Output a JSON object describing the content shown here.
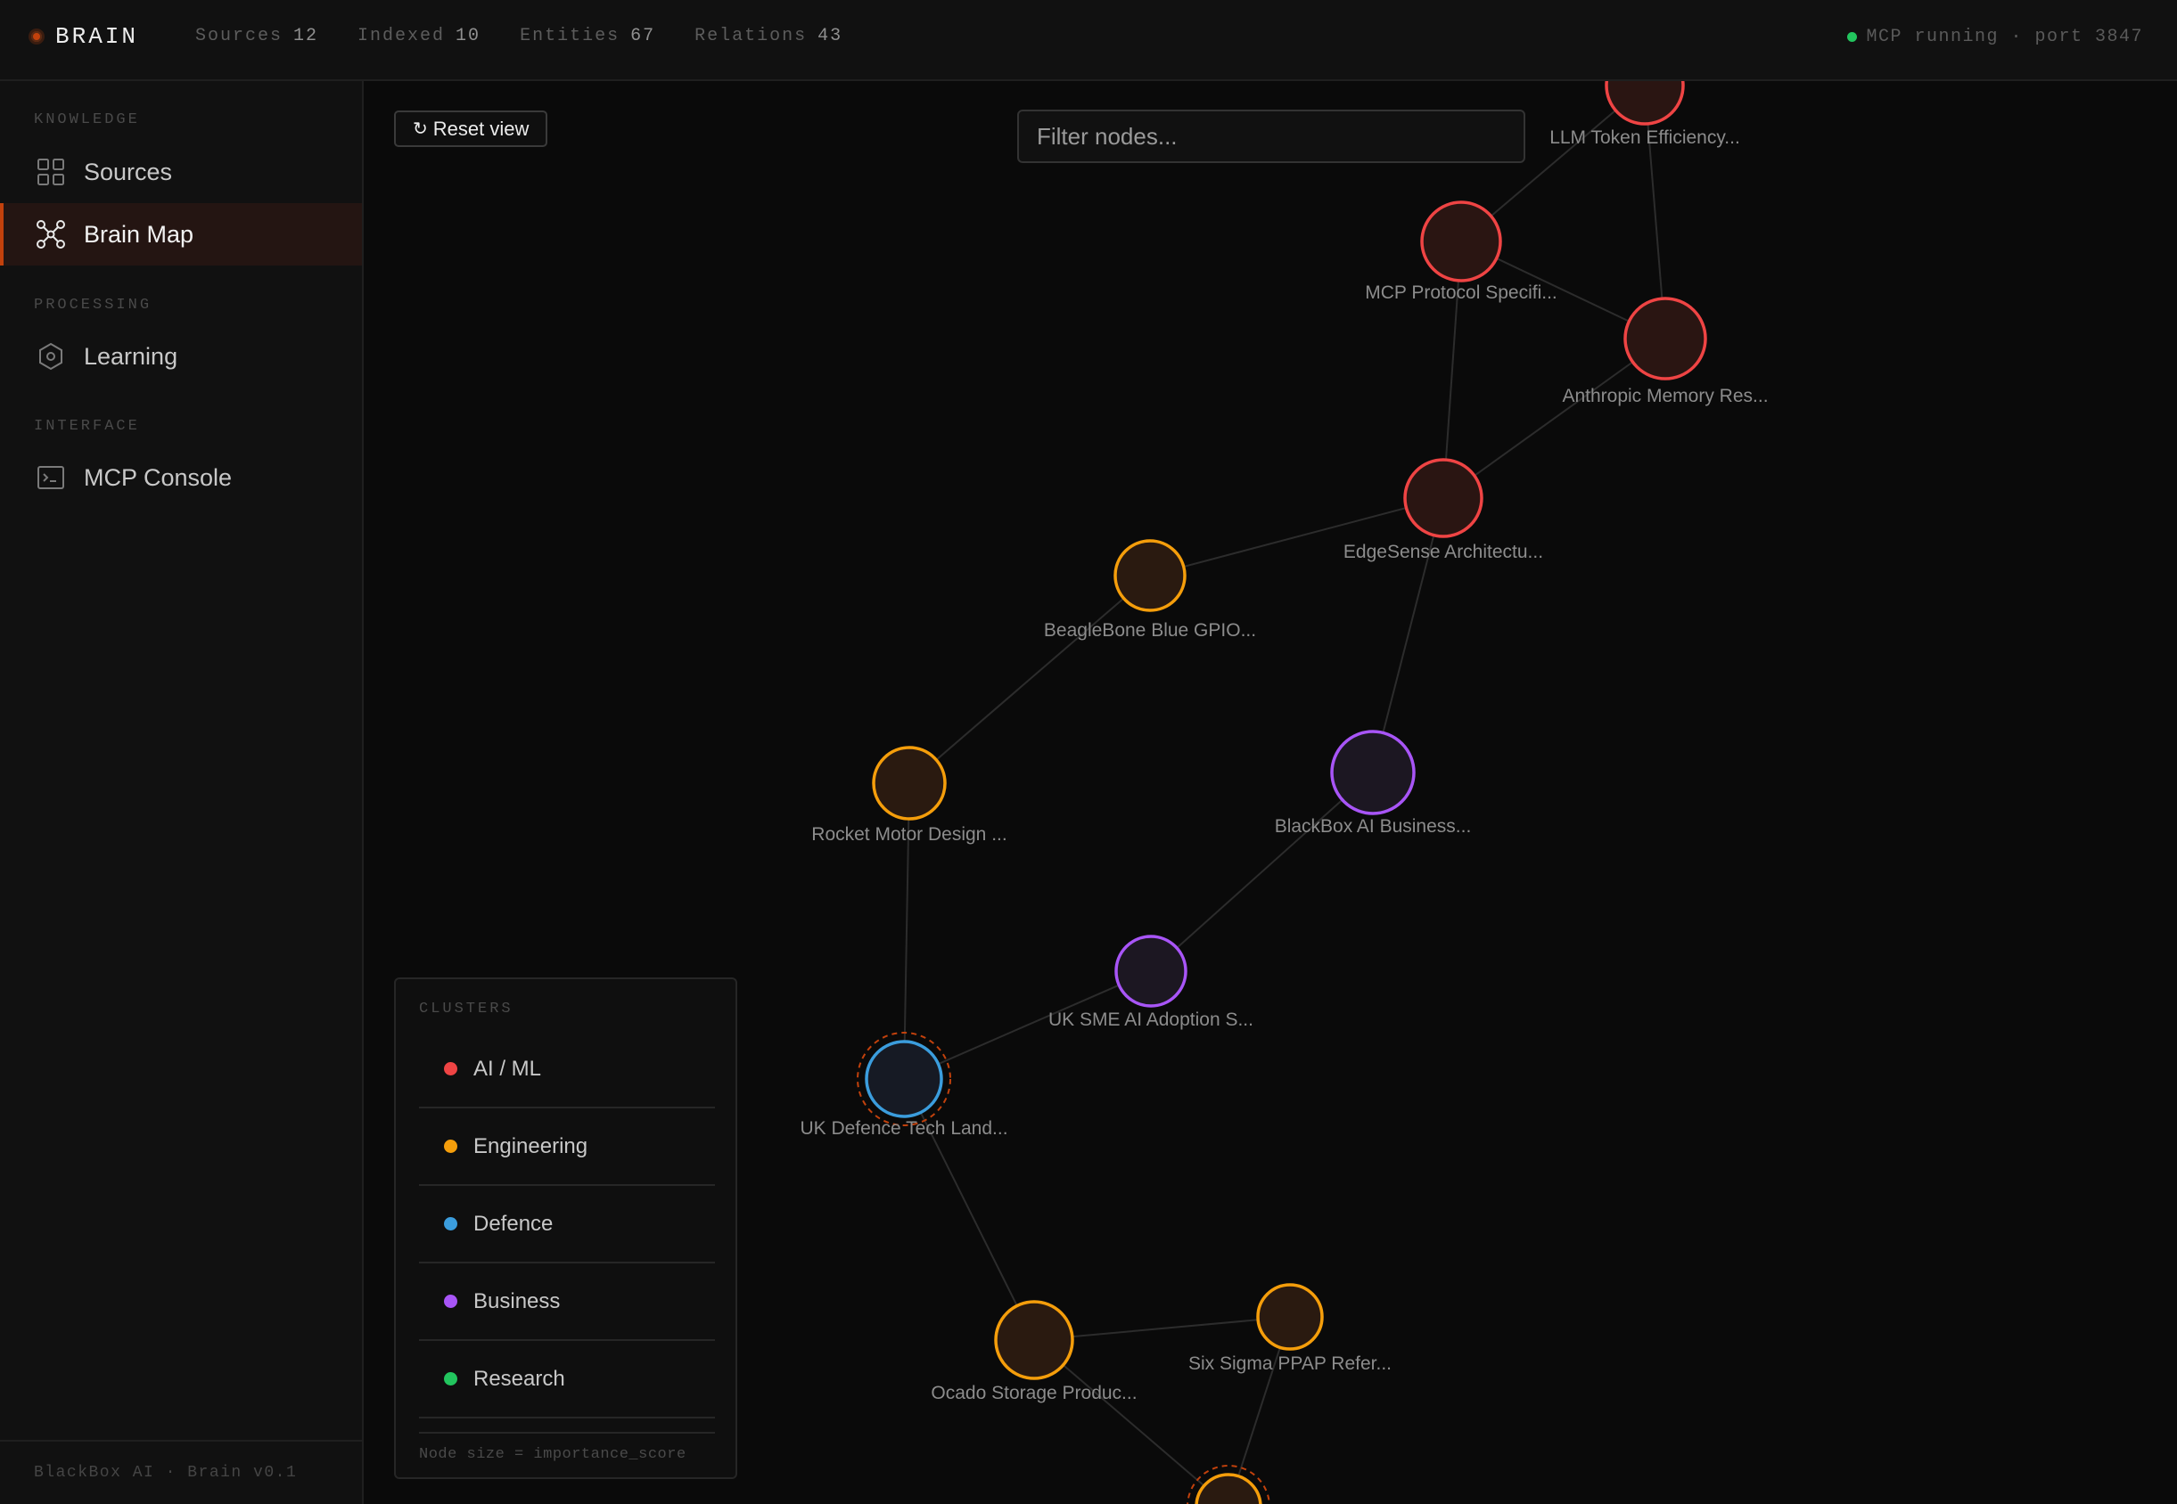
{
  "app": {
    "name": "BRAIN"
  },
  "stats": [
    {
      "label": "Sources",
      "value": "12"
    },
    {
      "label": "Indexed",
      "value": "10"
    },
    {
      "label": "Entities",
      "value": "67"
    },
    {
      "label": "Relations",
      "value": "43"
    }
  ],
  "mcp": {
    "status": "MCP running · port 3847",
    "status_color": "#22c55e"
  },
  "sidebar": {
    "sections": [
      {
        "label": "KNOWLEDGE"
      },
      {
        "label": "PROCESSING"
      },
      {
        "label": "INTERFACE"
      }
    ],
    "items": [
      {
        "label": "Sources",
        "icon": "grid-icon",
        "active": false
      },
      {
        "label": "Brain Map",
        "icon": "network-icon",
        "active": true
      },
      {
        "label": "Learning",
        "icon": "hexagon-icon",
        "active": false
      },
      {
        "label": "MCP Console",
        "icon": "terminal-icon",
        "active": false
      }
    ],
    "footer": "BlackBox AI · Brain v0.1"
  },
  "toolbar": {
    "reset_label": "Reset view",
    "reset_icon": "refresh-icon"
  },
  "filter": {
    "placeholder": "Filter nodes...",
    "value": ""
  },
  "legend": {
    "title": "CLUSTERS",
    "clusters": [
      {
        "label": "AI / ML",
        "color": "#ef4444"
      },
      {
        "label": "Engineering",
        "color": "#f59e0b"
      },
      {
        "label": "Defence",
        "color": "#3b9ddd"
      },
      {
        "label": "Business",
        "color": "#a855f7"
      },
      {
        "label": "Research",
        "color": "#22c55e"
      }
    ],
    "note": "Node size = importance_score"
  },
  "graph": {
    "nodes": [
      {
        "label": "LLM Token Efficiency...",
        "cluster": "AI / ML"
      },
      {
        "label": "MCP Protocol Specifi...",
        "cluster": "AI / ML"
      },
      {
        "label": "Anthropic Memory Res...",
        "cluster": "AI / ML"
      },
      {
        "label": "EdgeSense Architectu...",
        "cluster": "AI / ML"
      },
      {
        "label": "BeagleBone Blue GPIO...",
        "cluster": "Engineering"
      },
      {
        "label": "Rocket Motor Design ...",
        "cluster": "Engineering"
      },
      {
        "label": "BlackBox AI Business...",
        "cluster": "Business"
      },
      {
        "label": "UK SME AI Adoption S...",
        "cluster": "Business"
      },
      {
        "label": "UK Defence Tech Land...",
        "cluster": "Defence",
        "selected": true
      },
      {
        "label": "Ocado Storage Produc...",
        "cluster": "Engineering"
      },
      {
        "label": "Six Sigma PPAP Refer...",
        "cluster": "Engineering"
      },
      {
        "label": "",
        "cluster": "Engineering",
        "selected": true
      }
    ]
  }
}
